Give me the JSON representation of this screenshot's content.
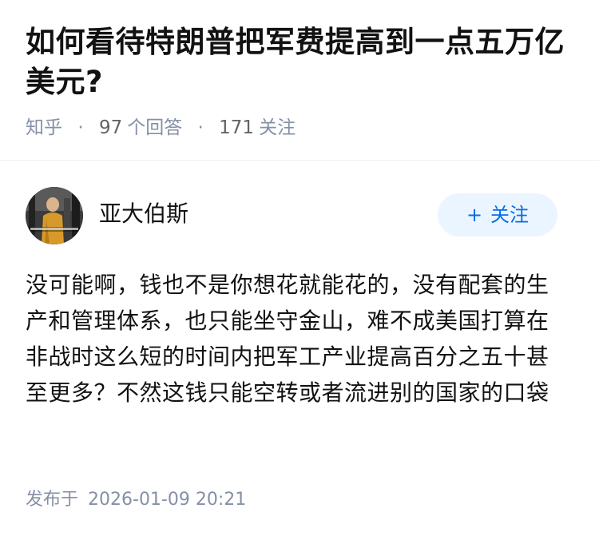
{
  "question": {
    "title": "如何看待特朗普把军费提高到一点五万亿美元?",
    "source": "知乎",
    "answer_count": "97",
    "answer_label": "个回答",
    "follow_count": "171",
    "follow_label": "关注",
    "separator": "·"
  },
  "author": {
    "name": "亚大伯斯",
    "avatar_icon": "avatar-photo",
    "follow_button_plus": "+",
    "follow_button_label": "关注"
  },
  "answer": {
    "content": "没可能啊，钱也不是你想花就能花的，没有配套的生产和管理体系，也只能坐守金山，难不成美国打算在非战时这么短的时间内把军工产业提高百分之五十甚至更多？不然这钱只能空转或者流进别的国家的口袋",
    "publish_label": "发布于",
    "publish_time": "2026-01-09 20:21"
  },
  "colors": {
    "accent": "#056de8",
    "follow_bg": "#ebf5ff",
    "meta_text": "#8590a6",
    "title_text": "#121212"
  }
}
